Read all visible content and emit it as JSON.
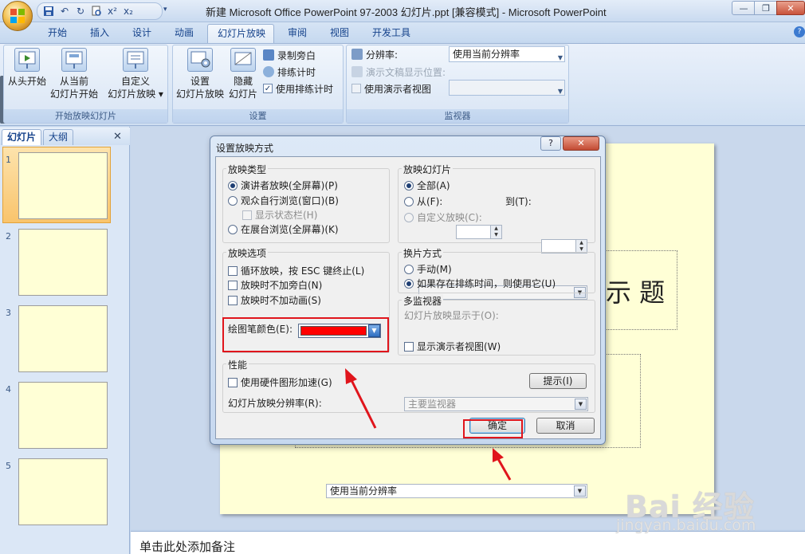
{
  "window": {
    "title": "新建 Microsoft Office PowerPoint 97-2003 幻灯片.ppt [兼容模式] - Microsoft PowerPoint",
    "qat_undo": "↶",
    "qat_redo": "↻",
    "qat_superscript": "x²",
    "qat_subscript": "x₂",
    "min": "—",
    "max": "❐",
    "close": "✕"
  },
  "ribbon_tabs": [
    "开始",
    "插入",
    "设计",
    "动画",
    "幻灯片放映",
    "审阅",
    "视图",
    "开发工具"
  ],
  "ribbon_active_tab": "幻灯片放映",
  "ribbon": {
    "group_start": {
      "label": "开始放映幻灯片",
      "from_beginning": "从头开始",
      "from_current_line1": "从当前",
      "from_current_line2": "幻灯片开始",
      "custom_line1": "自定义",
      "custom_line2": "幻灯片放映 ▾"
    },
    "group_setup": {
      "label": "设置",
      "setup_line1": "设置",
      "setup_line2": "幻灯片放映",
      "hide_line1": "隐藏",
      "hide_line2": "幻灯片",
      "record_narration": "录制旁白",
      "rehearse_timings": "排练计时",
      "use_rehearsed": "使用排练计时"
    },
    "group_monitors": {
      "label": "监视器",
      "resolution_label": "分辨率:",
      "resolution_value": "使用当前分辨率",
      "show_on_label": "演示文稿显示位置:",
      "presenter_view": "使用演示者视图"
    }
  },
  "left_pane": {
    "tab_slides": "幻灯片",
    "tab_outline": "大纲",
    "close": "✕",
    "slides": [
      "1",
      "2",
      "3",
      "4",
      "5"
    ]
  },
  "slide": {
    "title_fragment": "示  题"
  },
  "notes_placeholder": "单击此处添加备注",
  "dialog": {
    "title": "设置放映方式",
    "help": "?",
    "close": "✕",
    "show_type": {
      "legend": "放映类型",
      "speaker": "演讲者放映(全屏幕)(P)",
      "individual": "观众自行浏览(窗口)(B)",
      "show_scrollbar": "显示状态栏(H)",
      "kiosk": "在展台浏览(全屏幕)(K)"
    },
    "show_slides": {
      "legend": "放映幻灯片",
      "all": "全部(A)",
      "from": "从(F):",
      "to": "到(T):",
      "custom": "自定义放映(C):"
    },
    "show_options": {
      "legend": "放映选项",
      "loop": "循环放映，按 ESC 键终止(L)",
      "no_narration": "放映时不加旁白(N)",
      "no_animation": "放映时不加动画(S)",
      "pen_color": "绘图笔颜色(E):",
      "pen_color_value": "#ff0000"
    },
    "advance": {
      "legend": "换片方式",
      "manual": "手动(M)",
      "use_timings": "如果存在排练时间，则使用它(U)"
    },
    "multi_monitor": {
      "legend": "多监视器",
      "display_on": "幻灯片放映显示于(O):",
      "display_value": "主要监视器",
      "presenter_view": "显示演示者视图(W)"
    },
    "performance": {
      "legend": "性能",
      "hw_accel": "使用硬件图形加速(G)",
      "tips": "提示(I)",
      "resolution_label": "幻灯片放映分辨率(R):",
      "resolution_value": "使用当前分辨率"
    },
    "ok": "确定",
    "cancel": "取消"
  },
  "watermark": {
    "brand": "Bai 经验",
    "url": "jingyan.baidu.com"
  },
  "colors": {
    "accent_blue": "#15428b",
    "slide_bg": "#ffffd6",
    "highlight_red": "#e0151c",
    "selection_orange": "#f5b54a"
  }
}
